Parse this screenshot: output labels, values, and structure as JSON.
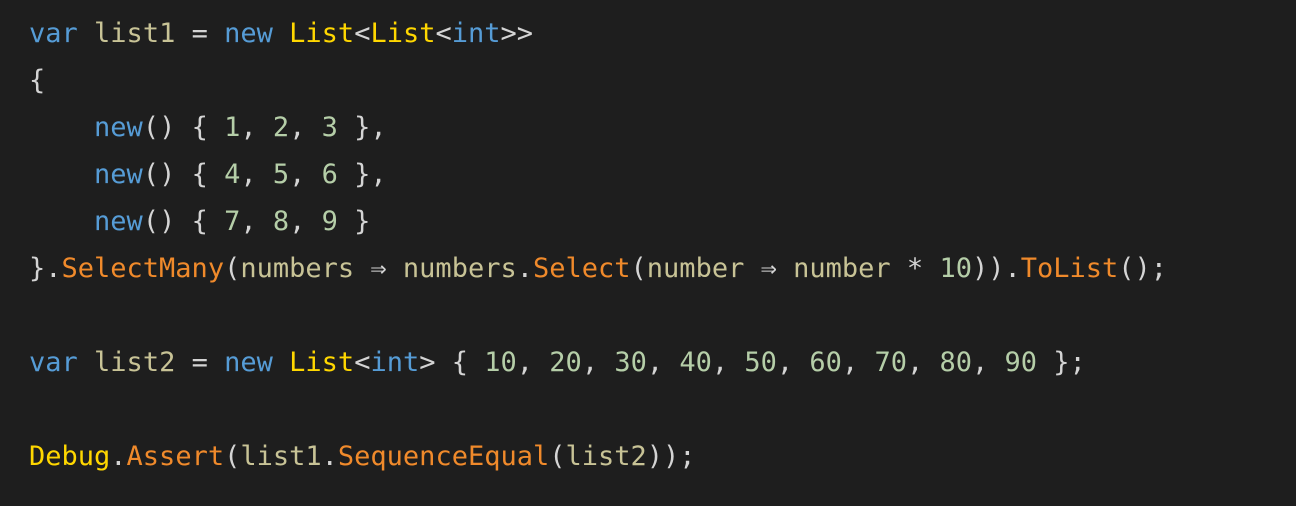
{
  "editor": {
    "colors": {
      "background": "#1e1e1e",
      "keyword": "#569cd6",
      "variable": "#c8c396",
      "type": "#ffd700",
      "method": "#f08a2b",
      "number": "#b5cea8",
      "punctuation": "#d4d4d4"
    },
    "lines": [
      {
        "tokens": [
          {
            "text": "var",
            "kind": "keyword"
          },
          {
            "text": " ",
            "kind": "punctuation"
          },
          {
            "text": "list1",
            "kind": "variable"
          },
          {
            "text": " = ",
            "kind": "punctuation"
          },
          {
            "text": "new",
            "kind": "keyword"
          },
          {
            "text": " ",
            "kind": "punctuation"
          },
          {
            "text": "List",
            "kind": "type"
          },
          {
            "text": "<",
            "kind": "punctuation"
          },
          {
            "text": "List",
            "kind": "type"
          },
          {
            "text": "<",
            "kind": "punctuation"
          },
          {
            "text": "int",
            "kind": "keyword"
          },
          {
            "text": ">>",
            "kind": "punctuation"
          }
        ]
      },
      {
        "tokens": [
          {
            "text": "{",
            "kind": "punctuation"
          }
        ]
      },
      {
        "tokens": [
          {
            "text": "    ",
            "kind": "punctuation"
          },
          {
            "text": "new",
            "kind": "keyword"
          },
          {
            "text": "() { ",
            "kind": "punctuation"
          },
          {
            "text": "1",
            "kind": "number"
          },
          {
            "text": ", ",
            "kind": "punctuation"
          },
          {
            "text": "2",
            "kind": "number"
          },
          {
            "text": ", ",
            "kind": "punctuation"
          },
          {
            "text": "3",
            "kind": "number"
          },
          {
            "text": " },",
            "kind": "punctuation"
          }
        ]
      },
      {
        "tokens": [
          {
            "text": "    ",
            "kind": "punctuation"
          },
          {
            "text": "new",
            "kind": "keyword"
          },
          {
            "text": "() { ",
            "kind": "punctuation"
          },
          {
            "text": "4",
            "kind": "number"
          },
          {
            "text": ", ",
            "kind": "punctuation"
          },
          {
            "text": "5",
            "kind": "number"
          },
          {
            "text": ", ",
            "kind": "punctuation"
          },
          {
            "text": "6",
            "kind": "number"
          },
          {
            "text": " },",
            "kind": "punctuation"
          }
        ]
      },
      {
        "tokens": [
          {
            "text": "    ",
            "kind": "punctuation"
          },
          {
            "text": "new",
            "kind": "keyword"
          },
          {
            "text": "() { ",
            "kind": "punctuation"
          },
          {
            "text": "7",
            "kind": "number"
          },
          {
            "text": ", ",
            "kind": "punctuation"
          },
          {
            "text": "8",
            "kind": "number"
          },
          {
            "text": ", ",
            "kind": "punctuation"
          },
          {
            "text": "9",
            "kind": "number"
          },
          {
            "text": " }",
            "kind": "punctuation"
          }
        ]
      },
      {
        "tokens": [
          {
            "text": "}.",
            "kind": "punctuation"
          },
          {
            "text": "SelectMany",
            "kind": "method"
          },
          {
            "text": "(",
            "kind": "punctuation"
          },
          {
            "text": "numbers",
            "kind": "variable"
          },
          {
            "text": " ⇒ ",
            "kind": "punctuation"
          },
          {
            "text": "numbers",
            "kind": "variable"
          },
          {
            "text": ".",
            "kind": "punctuation"
          },
          {
            "text": "Select",
            "kind": "method"
          },
          {
            "text": "(",
            "kind": "punctuation"
          },
          {
            "text": "number",
            "kind": "variable"
          },
          {
            "text": " ⇒ ",
            "kind": "punctuation"
          },
          {
            "text": "number",
            "kind": "variable"
          },
          {
            "text": " * ",
            "kind": "punctuation"
          },
          {
            "text": "10",
            "kind": "number"
          },
          {
            "text": ")).",
            "kind": "punctuation"
          },
          {
            "text": "ToList",
            "kind": "method"
          },
          {
            "text": "();",
            "kind": "punctuation"
          }
        ]
      },
      {
        "tokens": []
      },
      {
        "tokens": [
          {
            "text": "var",
            "kind": "keyword"
          },
          {
            "text": " ",
            "kind": "punctuation"
          },
          {
            "text": "list2",
            "kind": "variable"
          },
          {
            "text": " = ",
            "kind": "punctuation"
          },
          {
            "text": "new",
            "kind": "keyword"
          },
          {
            "text": " ",
            "kind": "punctuation"
          },
          {
            "text": "List",
            "kind": "type"
          },
          {
            "text": "<",
            "kind": "punctuation"
          },
          {
            "text": "int",
            "kind": "keyword"
          },
          {
            "text": "> { ",
            "kind": "punctuation"
          },
          {
            "text": "10",
            "kind": "number"
          },
          {
            "text": ", ",
            "kind": "punctuation"
          },
          {
            "text": "20",
            "kind": "number"
          },
          {
            "text": ", ",
            "kind": "punctuation"
          },
          {
            "text": "30",
            "kind": "number"
          },
          {
            "text": ", ",
            "kind": "punctuation"
          },
          {
            "text": "40",
            "kind": "number"
          },
          {
            "text": ", ",
            "kind": "punctuation"
          },
          {
            "text": "50",
            "kind": "number"
          },
          {
            "text": ", ",
            "kind": "punctuation"
          },
          {
            "text": "60",
            "kind": "number"
          },
          {
            "text": ", ",
            "kind": "punctuation"
          },
          {
            "text": "70",
            "kind": "number"
          },
          {
            "text": ", ",
            "kind": "punctuation"
          },
          {
            "text": "80",
            "kind": "number"
          },
          {
            "text": ", ",
            "kind": "punctuation"
          },
          {
            "text": "90",
            "kind": "number"
          },
          {
            "text": " };",
            "kind": "punctuation"
          }
        ]
      },
      {
        "tokens": []
      },
      {
        "tokens": [
          {
            "text": "Debug",
            "kind": "type"
          },
          {
            "text": ".",
            "kind": "punctuation"
          },
          {
            "text": "Assert",
            "kind": "method"
          },
          {
            "text": "(",
            "kind": "punctuation"
          },
          {
            "text": "list1",
            "kind": "variable"
          },
          {
            "text": ".",
            "kind": "punctuation"
          },
          {
            "text": "SequenceEqual",
            "kind": "method"
          },
          {
            "text": "(",
            "kind": "punctuation"
          },
          {
            "text": "list2",
            "kind": "variable"
          },
          {
            "text": "));",
            "kind": "punctuation"
          }
        ]
      }
    ]
  }
}
